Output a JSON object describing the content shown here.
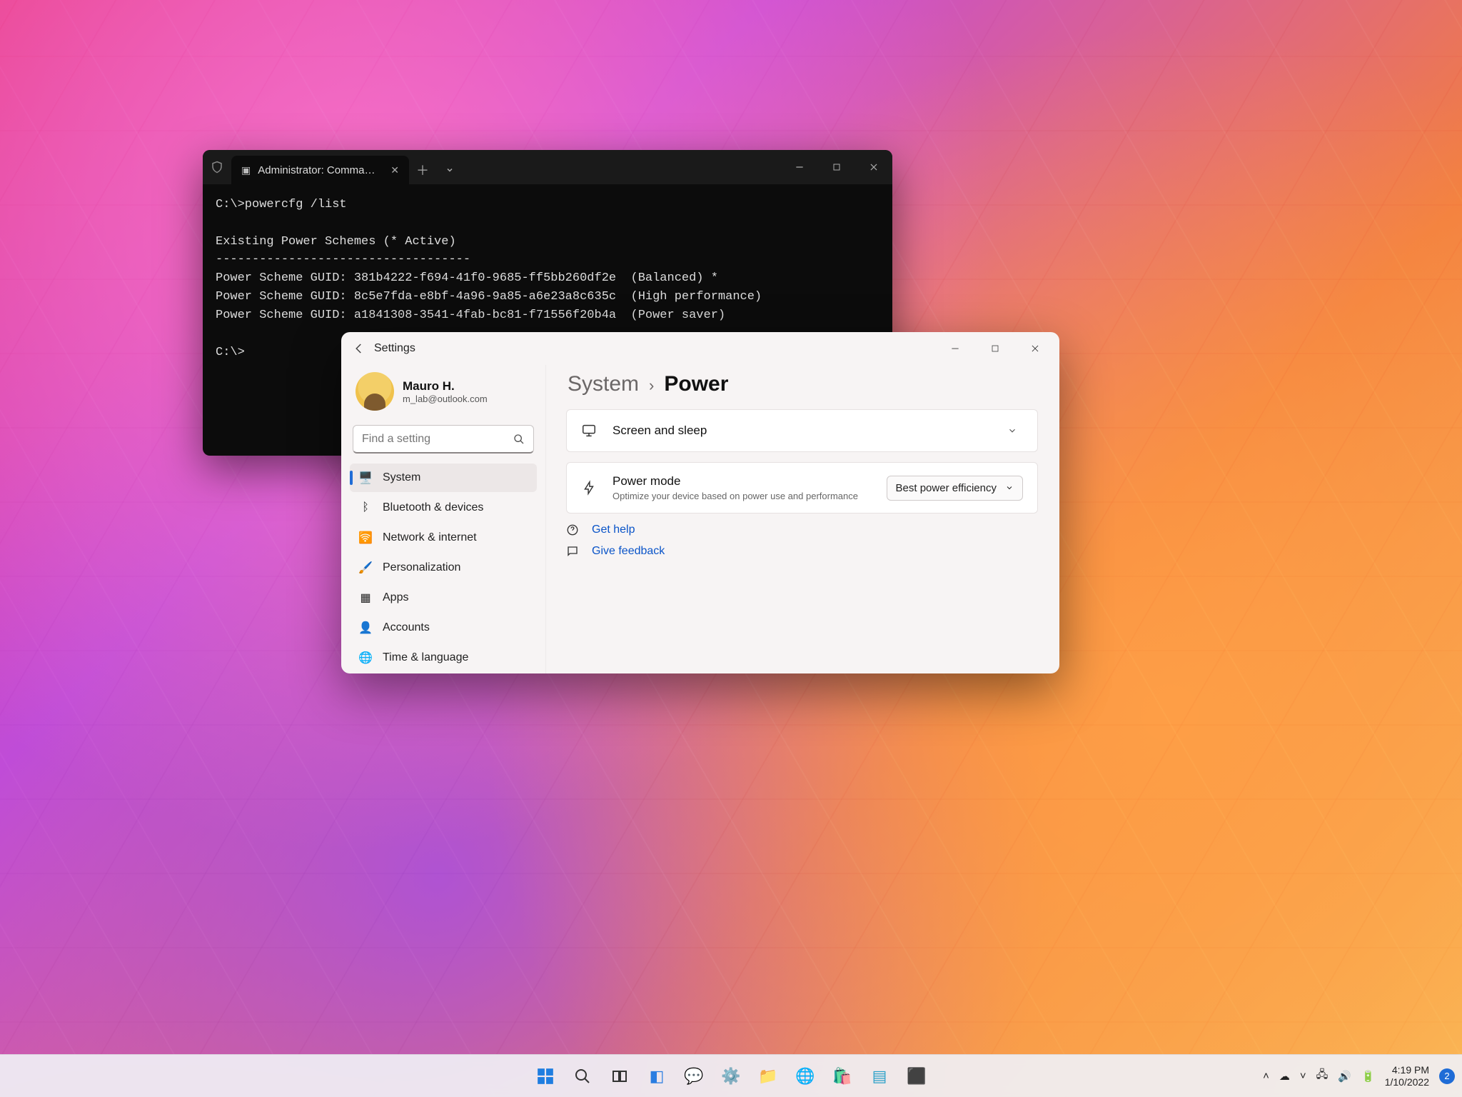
{
  "terminal": {
    "tab_title": "Administrator: Command Prom…",
    "lines": [
      "C:\\>powercfg /list",
      "",
      "Existing Power Schemes (* Active)",
      "-----------------------------------",
      "Power Scheme GUID: 381b4222-f694-41f0-9685-ff5bb260df2e  (Balanced) *",
      "Power Scheme GUID: 8c5e7fda-e8bf-4a96-9a85-a6e23a8c635c  (High performance)",
      "Power Scheme GUID: a1841308-3541-4fab-bc81-f71556f20b4a  (Power saver)",
      "",
      "C:\\>"
    ]
  },
  "settings": {
    "app_title": "Settings",
    "profile": {
      "name": "Mauro H.",
      "email": "m_lab@outlook.com"
    },
    "search_placeholder": "Find a setting",
    "nav": [
      {
        "label": "System",
        "icon": "🖥️",
        "active": true
      },
      {
        "label": "Bluetooth & devices",
        "icon": "ᛒ",
        "active": false
      },
      {
        "label": "Network & internet",
        "icon": "🛜",
        "active": false
      },
      {
        "label": "Personalization",
        "icon": "🖌️",
        "active": false
      },
      {
        "label": "Apps",
        "icon": "▦",
        "active": false
      },
      {
        "label": "Accounts",
        "icon": "👤",
        "active": false
      },
      {
        "label": "Time & language",
        "icon": "🌐",
        "active": false
      }
    ],
    "breadcrumb": {
      "parent": "System",
      "current": "Power"
    },
    "screen_sleep_label": "Screen and sleep",
    "power_mode": {
      "title": "Power mode",
      "subtitle": "Optimize your device based on power use and performance",
      "selected": "Best power efficiency"
    },
    "help_link": "Get help",
    "feedback_link": "Give feedback"
  },
  "taskbar": {
    "time": "4:19 PM",
    "date": "1/10/2022",
    "badge": "2"
  }
}
